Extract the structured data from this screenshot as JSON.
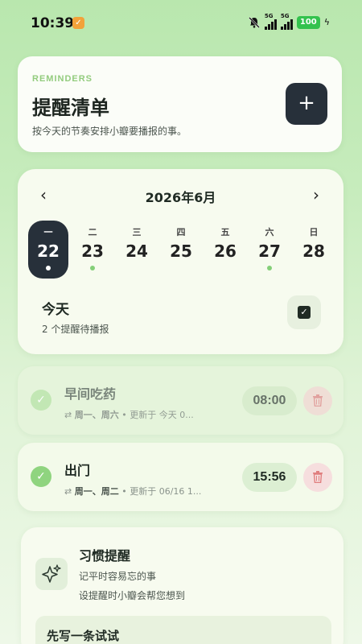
{
  "status_bar": {
    "time": "10:39",
    "net1": "5G",
    "net2": "5G",
    "battery": "100"
  },
  "header": {
    "kicker": "REMINDERS",
    "title": "提醒清单",
    "subtitle": "按今天的节奏安排小瓣要播报的事。",
    "add_label": "+"
  },
  "calendar": {
    "month": "2026年6月",
    "prev": "‹",
    "next": "›",
    "days": [
      {
        "weekday": "一",
        "day": "22",
        "selected": true,
        "dot": true
      },
      {
        "weekday": "二",
        "day": "23",
        "selected": false,
        "dot": true
      },
      {
        "weekday": "三",
        "day": "24",
        "selected": false,
        "dot": false
      },
      {
        "weekday": "四",
        "day": "25",
        "selected": false,
        "dot": false
      },
      {
        "weekday": "五",
        "day": "26",
        "selected": false,
        "dot": false
      },
      {
        "weekday": "六",
        "day": "27",
        "selected": false,
        "dot": true
      },
      {
        "weekday": "日",
        "day": "28",
        "selected": false,
        "dot": false
      }
    ],
    "today_label": "今天",
    "today_summary": "2 个提醒待播报"
  },
  "reminders": [
    {
      "title": "早间吃药",
      "repeat": "周一、周六",
      "updated": "• 更新于 今天 0...",
      "time": "08:00",
      "done": true
    },
    {
      "title": "出门",
      "repeat": "周一、周二",
      "updated": "• 更新于 06/16 1...",
      "time": "15:56",
      "done": true
    }
  ],
  "habit": {
    "title": "习惯提醒",
    "line1": "记平时容易忘的事",
    "line2": "设提醒时小瓣会帮您想到",
    "try_label": "先写一条试试"
  },
  "colors": {
    "accent": "#84cf78",
    "dark_button": "#27303a",
    "delete_bg": "#f6dede"
  }
}
